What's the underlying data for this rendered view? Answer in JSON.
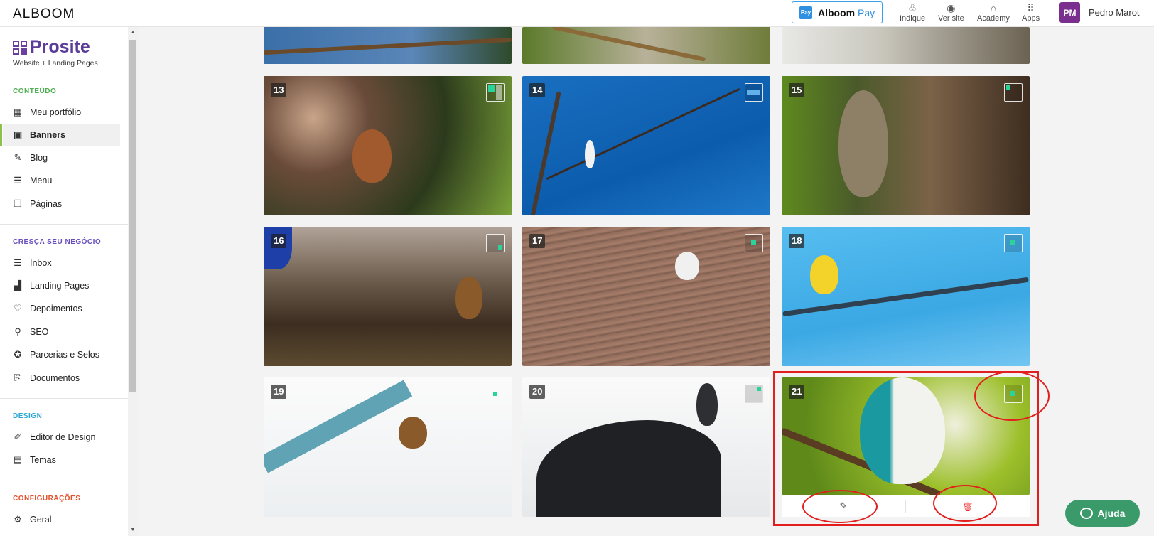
{
  "topbar": {
    "logo": "ALBOOM",
    "pay": {
      "badge": "Pay",
      "label": "Alboom",
      "label_accent": "Pay"
    },
    "nav": [
      {
        "label": "Indique",
        "icon": "gift-icon"
      },
      {
        "label": "Ver site",
        "icon": "eye-icon"
      },
      {
        "label": "Academy",
        "icon": "academy-icon"
      },
      {
        "label": "Apps",
        "icon": "grid-icon"
      }
    ],
    "user": {
      "initials": "PM",
      "name": "Pedro Marot"
    }
  },
  "sidebar": {
    "brand": {
      "name": "Prosite",
      "subtitle": "Website + Landing Pages"
    },
    "sections": [
      {
        "title": "CONTEÚDO",
        "color": "#4caf50",
        "items": [
          {
            "label": "Meu portfólio",
            "icon": "portfolio-icon"
          },
          {
            "label": "Banners",
            "icon": "image-icon",
            "active": true
          },
          {
            "label": "Blog",
            "icon": "blog-icon"
          },
          {
            "label": "Menu",
            "icon": "menu-icon"
          },
          {
            "label": "Páginas",
            "icon": "pages-icon"
          }
        ]
      },
      {
        "title": "CRESÇA SEU NEGÓCIO",
        "color": "#6a4fbf",
        "items": [
          {
            "label": "Inbox",
            "icon": "inbox-icon"
          },
          {
            "label": "Landing Pages",
            "icon": "chart-icon"
          },
          {
            "label": "Depoimentos",
            "icon": "testimonial-icon"
          },
          {
            "label": "SEO",
            "icon": "seo-icon"
          },
          {
            "label": "Parcerias e Selos",
            "icon": "badge-icon"
          },
          {
            "label": "Documentos",
            "icon": "document-icon"
          }
        ]
      },
      {
        "title": "DESIGN",
        "color": "#2aa6d6",
        "items": [
          {
            "label": "Editor de Design",
            "icon": "brush-icon"
          },
          {
            "label": "Temas",
            "icon": "themes-icon"
          }
        ]
      },
      {
        "title": "CONFIGURAÇÕES",
        "color": "#e0502a",
        "items": [
          {
            "label": "Geral",
            "icon": "settings-icon"
          }
        ]
      }
    ]
  },
  "banners": [
    {
      "num": "13"
    },
    {
      "num": "14"
    },
    {
      "num": "15"
    },
    {
      "num": "16"
    },
    {
      "num": "17"
    },
    {
      "num": "18"
    },
    {
      "num": "19"
    },
    {
      "num": "20"
    },
    {
      "num": "21"
    }
  ],
  "tile_actions": {
    "edit_icon": "✎",
    "delete_icon": "🗑"
  },
  "help": {
    "label": "Ajuda"
  }
}
